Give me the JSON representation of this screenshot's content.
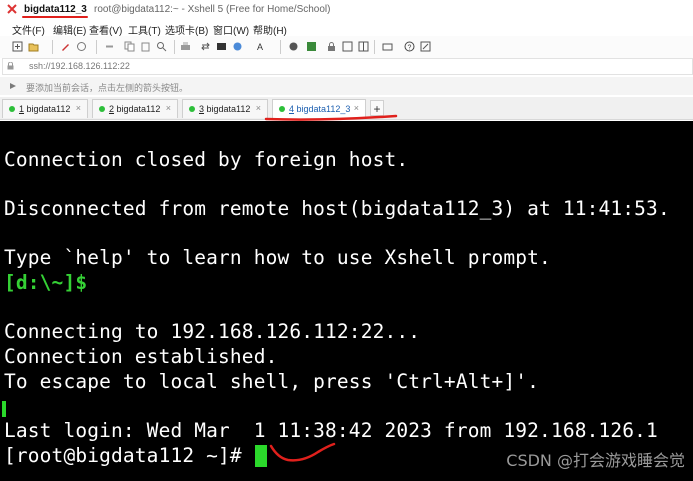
{
  "window": {
    "session_title": "bigdata112_3",
    "caption": "root@bigdata112:~ - Xshell 5 (Free for Home/School)"
  },
  "menu": [
    "文件(F)",
    "编辑(E)",
    "查看(V)",
    "工具(T)",
    "选项卡(B)",
    "窗口(W)",
    "帮助(H)"
  ],
  "address": {
    "url": "ssh://192.168.126.112:22"
  },
  "hint": {
    "text": "要添加当前会话，点击左侧的箭头按钮。"
  },
  "tabs": [
    {
      "num": "1",
      "label": "bigdata112",
      "active": false
    },
    {
      "num": "2",
      "label": "bigdata112",
      "active": false
    },
    {
      "num": "3",
      "label": "bigdata112",
      "active": false
    },
    {
      "num": "4",
      "label": "bigdata112_3",
      "active": true
    }
  ],
  "tab_add_label": "+",
  "tab_close_label": "×",
  "terminal": {
    "lines": [
      "Connection closed by foreign host.",
      "Disconnected from remote host(bigdata112_3) at 11:41:53.",
      "Type `help' to learn how to use Xshell prompt.",
      "[d:\\~]$",
      "Connecting to 192.168.126.112:22...",
      "Connection established.",
      "To escape to local shell, press 'Ctrl+Alt+]'.",
      "Last login: Wed Mar  1 11:38:42 2023 from 192.168.126.1",
      "[root@bigdata112 ~]#"
    ]
  },
  "watermark": "CSDN @打会游戏睡会觉",
  "colors": {
    "terminal_bg": "#000000",
    "terminal_fg": "#ffffff",
    "prompt_green": "#35d035",
    "annotation_red": "#e0201c",
    "active_tab_text": "#1c5fb0"
  }
}
